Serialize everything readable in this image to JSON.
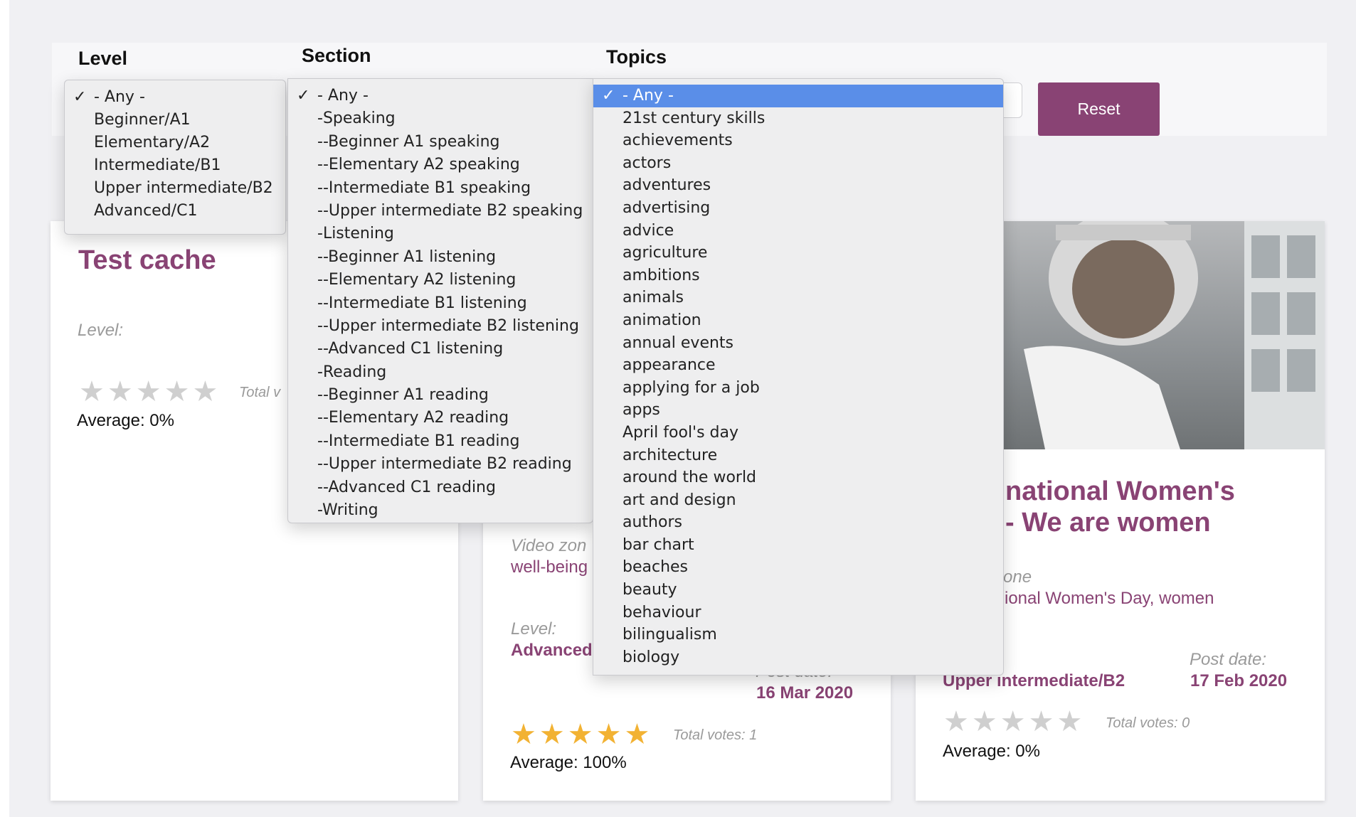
{
  "filters": {
    "level_label": "Level",
    "section_label": "Section",
    "topics_label": "Topics",
    "reset_label": "Reset",
    "check_glyph": "✓"
  },
  "level_options": [
    {
      "label": "- Any -",
      "selected": true
    },
    {
      "label": "Beginner/A1"
    },
    {
      "label": "Elementary/A2"
    },
    {
      "label": "Intermediate/B1"
    },
    {
      "label": "Upper intermediate/B2"
    },
    {
      "label": "Advanced/C1"
    }
  ],
  "section_options": [
    {
      "label": "- Any -",
      "selected": true
    },
    {
      "label": "-Speaking"
    },
    {
      "label": "--Beginner A1 speaking"
    },
    {
      "label": "--Elementary A2 speaking"
    },
    {
      "label": "--Intermediate B1 speaking"
    },
    {
      "label": "--Upper intermediate B2 speaking"
    },
    {
      "label": "-Listening"
    },
    {
      "label": "--Beginner A1 listening"
    },
    {
      "label": "--Elementary A2 listening"
    },
    {
      "label": "--Intermediate B1 listening"
    },
    {
      "label": "--Upper intermediate B2 listening"
    },
    {
      "label": "--Advanced C1 listening"
    },
    {
      "label": "-Reading"
    },
    {
      "label": "--Beginner A1 reading"
    },
    {
      "label": "--Elementary A2 reading"
    },
    {
      "label": "--Intermediate B1 reading"
    },
    {
      "label": "--Upper intermediate B2 reading"
    },
    {
      "label": "--Advanced C1 reading"
    },
    {
      "label": "-Writing"
    }
  ],
  "topics_options": [
    {
      "label": "- Any -",
      "selected": true
    },
    {
      "label": "21st century skills"
    },
    {
      "label": "achievements"
    },
    {
      "label": "actors"
    },
    {
      "label": "adventures"
    },
    {
      "label": "advertising"
    },
    {
      "label": "advice"
    },
    {
      "label": "agriculture"
    },
    {
      "label": "ambitions"
    },
    {
      "label": "animals"
    },
    {
      "label": "animation"
    },
    {
      "label": "annual events"
    },
    {
      "label": "appearance"
    },
    {
      "label": "applying for a job"
    },
    {
      "label": "apps"
    },
    {
      "label": "April fool's day"
    },
    {
      "label": "architecture"
    },
    {
      "label": "around the world"
    },
    {
      "label": "art and design"
    },
    {
      "label": "authors"
    },
    {
      "label": "bar chart"
    },
    {
      "label": "beaches"
    },
    {
      "label": "beauty"
    },
    {
      "label": "behaviour"
    },
    {
      "label": "bilingualism"
    },
    {
      "label": "biology"
    }
  ],
  "cards": [
    {
      "title": "Test cache",
      "level_label": "Level:",
      "votes_text": "Total v",
      "average_text": "Average: 0%",
      "rating": 0
    },
    {
      "zone_text": "Video zon",
      "tags_text": "well-being",
      "level_label": "Level:",
      "level_value": "Advanced",
      "post_date_label": "Post date:",
      "post_date": "16 Mar 2020",
      "votes_text": "Total votes: 1",
      "average_text": "Average: 100%",
      "rating": 5
    },
    {
      "title_line1": "national Women's",
      "title_line2": "- We are women",
      "zone_text": "one",
      "tags_text": "ional Women's Day, women",
      "level_value": "Upper intermediate/B2",
      "post_date_label": "Post date:",
      "post_date": "17 Feb 2020",
      "votes_text": "Total votes: 0",
      "average_text": "Average: 0%",
      "rating": 0
    }
  ],
  "colors": {
    "accent": "#894374",
    "star_on": "#f2b233",
    "star_off": "#cfcfcf",
    "selection": "#5a8ee8"
  },
  "icons": {
    "star": "★"
  }
}
